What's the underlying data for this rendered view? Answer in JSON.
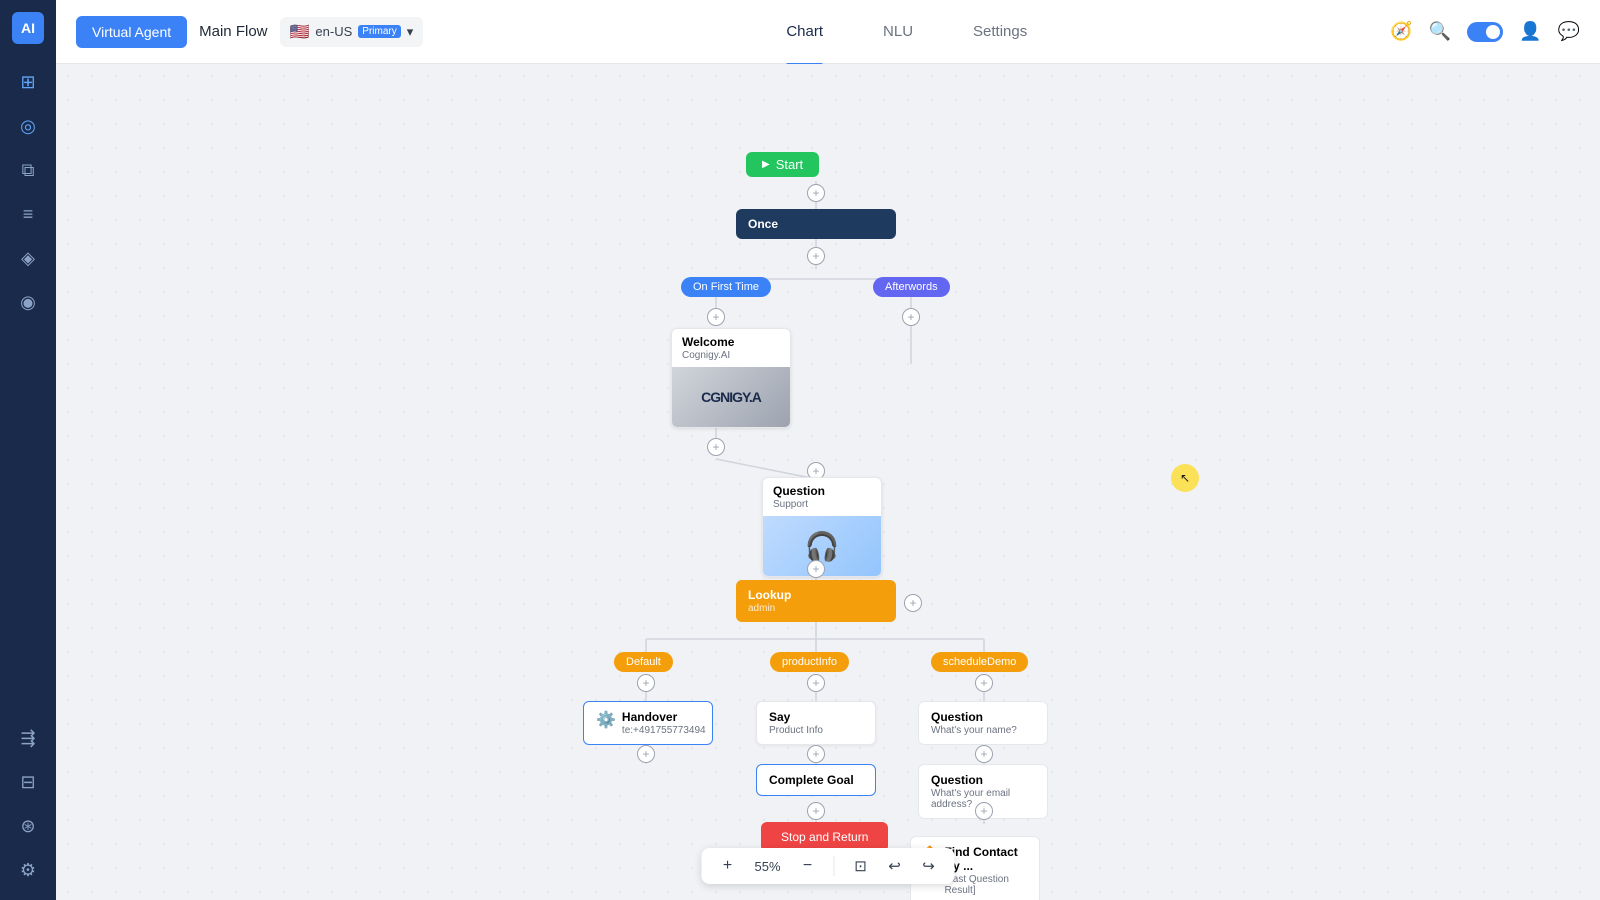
{
  "sidebar": {
    "logo": "AI",
    "items": [
      {
        "name": "grid-icon",
        "icon": "⊞",
        "active": false
      },
      {
        "name": "flow-icon",
        "icon": "◎",
        "active": true
      },
      {
        "name": "layers-icon",
        "icon": "⧉",
        "active": false
      },
      {
        "name": "list-icon",
        "icon": "≡",
        "active": false
      },
      {
        "name": "search-icon",
        "icon": "◈",
        "active": false
      },
      {
        "name": "bulb-icon",
        "icon": "◉",
        "active": false
      },
      {
        "name": "route-icon",
        "icon": "⇶",
        "active": false
      },
      {
        "name": "extension-icon",
        "icon": "⊟",
        "active": false
      },
      {
        "name": "integration-icon",
        "icon": "⊛",
        "active": false
      },
      {
        "name": "settings-icon",
        "icon": "⚙",
        "active": false
      }
    ]
  },
  "topbar": {
    "virtual_agent_label": "Virtual Agent",
    "main_flow_label": "Main Flow",
    "language_code": "en-US",
    "language_badge": "Primary",
    "tabs": [
      {
        "name": "chart-tab",
        "label": "Chart",
        "active": true
      },
      {
        "name": "nlu-tab",
        "label": "NLU",
        "active": false
      },
      {
        "name": "settings-tab",
        "label": "Settings",
        "active": false
      }
    ],
    "icons": [
      {
        "name": "compass-icon",
        "icon": "⊕"
      },
      {
        "name": "search-icon",
        "icon": "🔍"
      },
      {
        "name": "user-icon",
        "icon": "👤"
      },
      {
        "name": "chat-icon",
        "icon": "💬"
      }
    ]
  },
  "canvas": {
    "nodes": {
      "start": {
        "label": "Start"
      },
      "once": {
        "label": "Once"
      },
      "on_first_time": {
        "label": "On First Time"
      },
      "afterwords": {
        "label": "Afterwords"
      },
      "welcome": {
        "title": "Welcome",
        "sub": "Cognigy.AI"
      },
      "question_support": {
        "title": "Question",
        "sub": "Support"
      },
      "lookup": {
        "title": "Lookup",
        "sub": "admin"
      },
      "default_badge": {
        "label": "Default"
      },
      "product_info_badge": {
        "label": "productInfo"
      },
      "schedule_demo_badge": {
        "label": "scheduleDemo"
      },
      "handover": {
        "title": "Handover",
        "phone": "te:+491755773494"
      },
      "say_product": {
        "title": "Say",
        "sub": "Product Info"
      },
      "question_name": {
        "title": "Question",
        "sub": "What's your name?"
      },
      "complete_goal": {
        "title": "Complete Goal"
      },
      "question_email": {
        "title": "Question",
        "sub": "What's your email address?"
      },
      "stop_return": {
        "label": "Stop and Return"
      },
      "find_contact": {
        "title": "Find Contact By ...",
        "sub": "[Last Question Result]"
      }
    },
    "zoom_level": "55%"
  },
  "toolbar": {
    "zoom_in": "+",
    "zoom_level": "55%",
    "zoom_out": "−",
    "fit": "⊡",
    "undo": "↩",
    "redo": "↪"
  }
}
